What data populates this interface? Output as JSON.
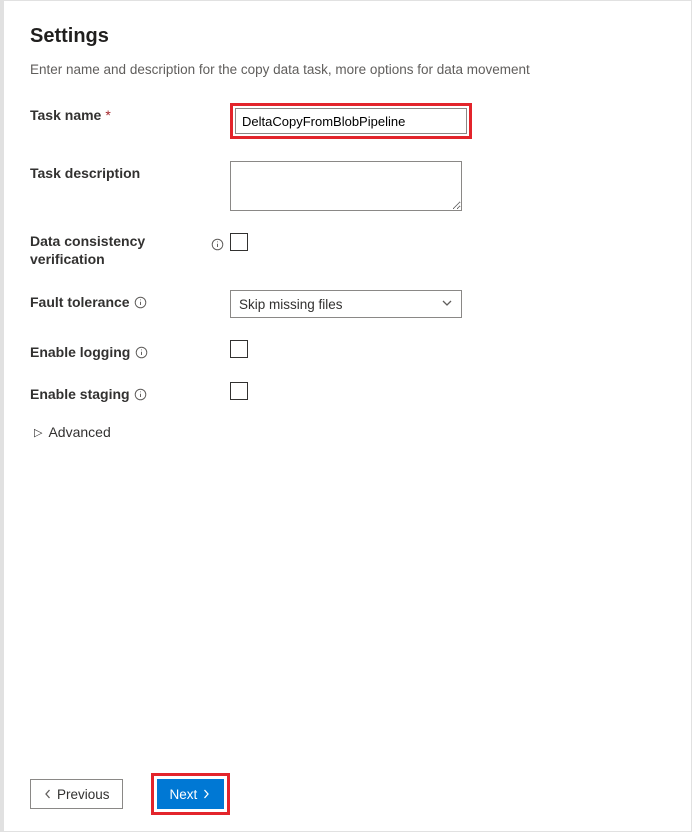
{
  "header": {
    "title": "Settings",
    "subtitle": "Enter name and description for the copy data task, more options for data movement"
  },
  "labels": {
    "task_name": "Task name",
    "task_description": "Task description",
    "data_consistency": "Data consistency verification",
    "fault_tolerance": "Fault tolerance",
    "enable_logging": "Enable logging",
    "enable_staging": "Enable staging",
    "advanced": "Advanced"
  },
  "values": {
    "task_name": "DeltaCopyFromBlobPipeline",
    "task_description": "",
    "fault_tolerance_selected": "Skip missing files",
    "data_consistency_checked": false,
    "enable_logging_checked": false,
    "enable_staging_checked": false
  },
  "footer": {
    "previous": "Previous",
    "next": "Next"
  }
}
